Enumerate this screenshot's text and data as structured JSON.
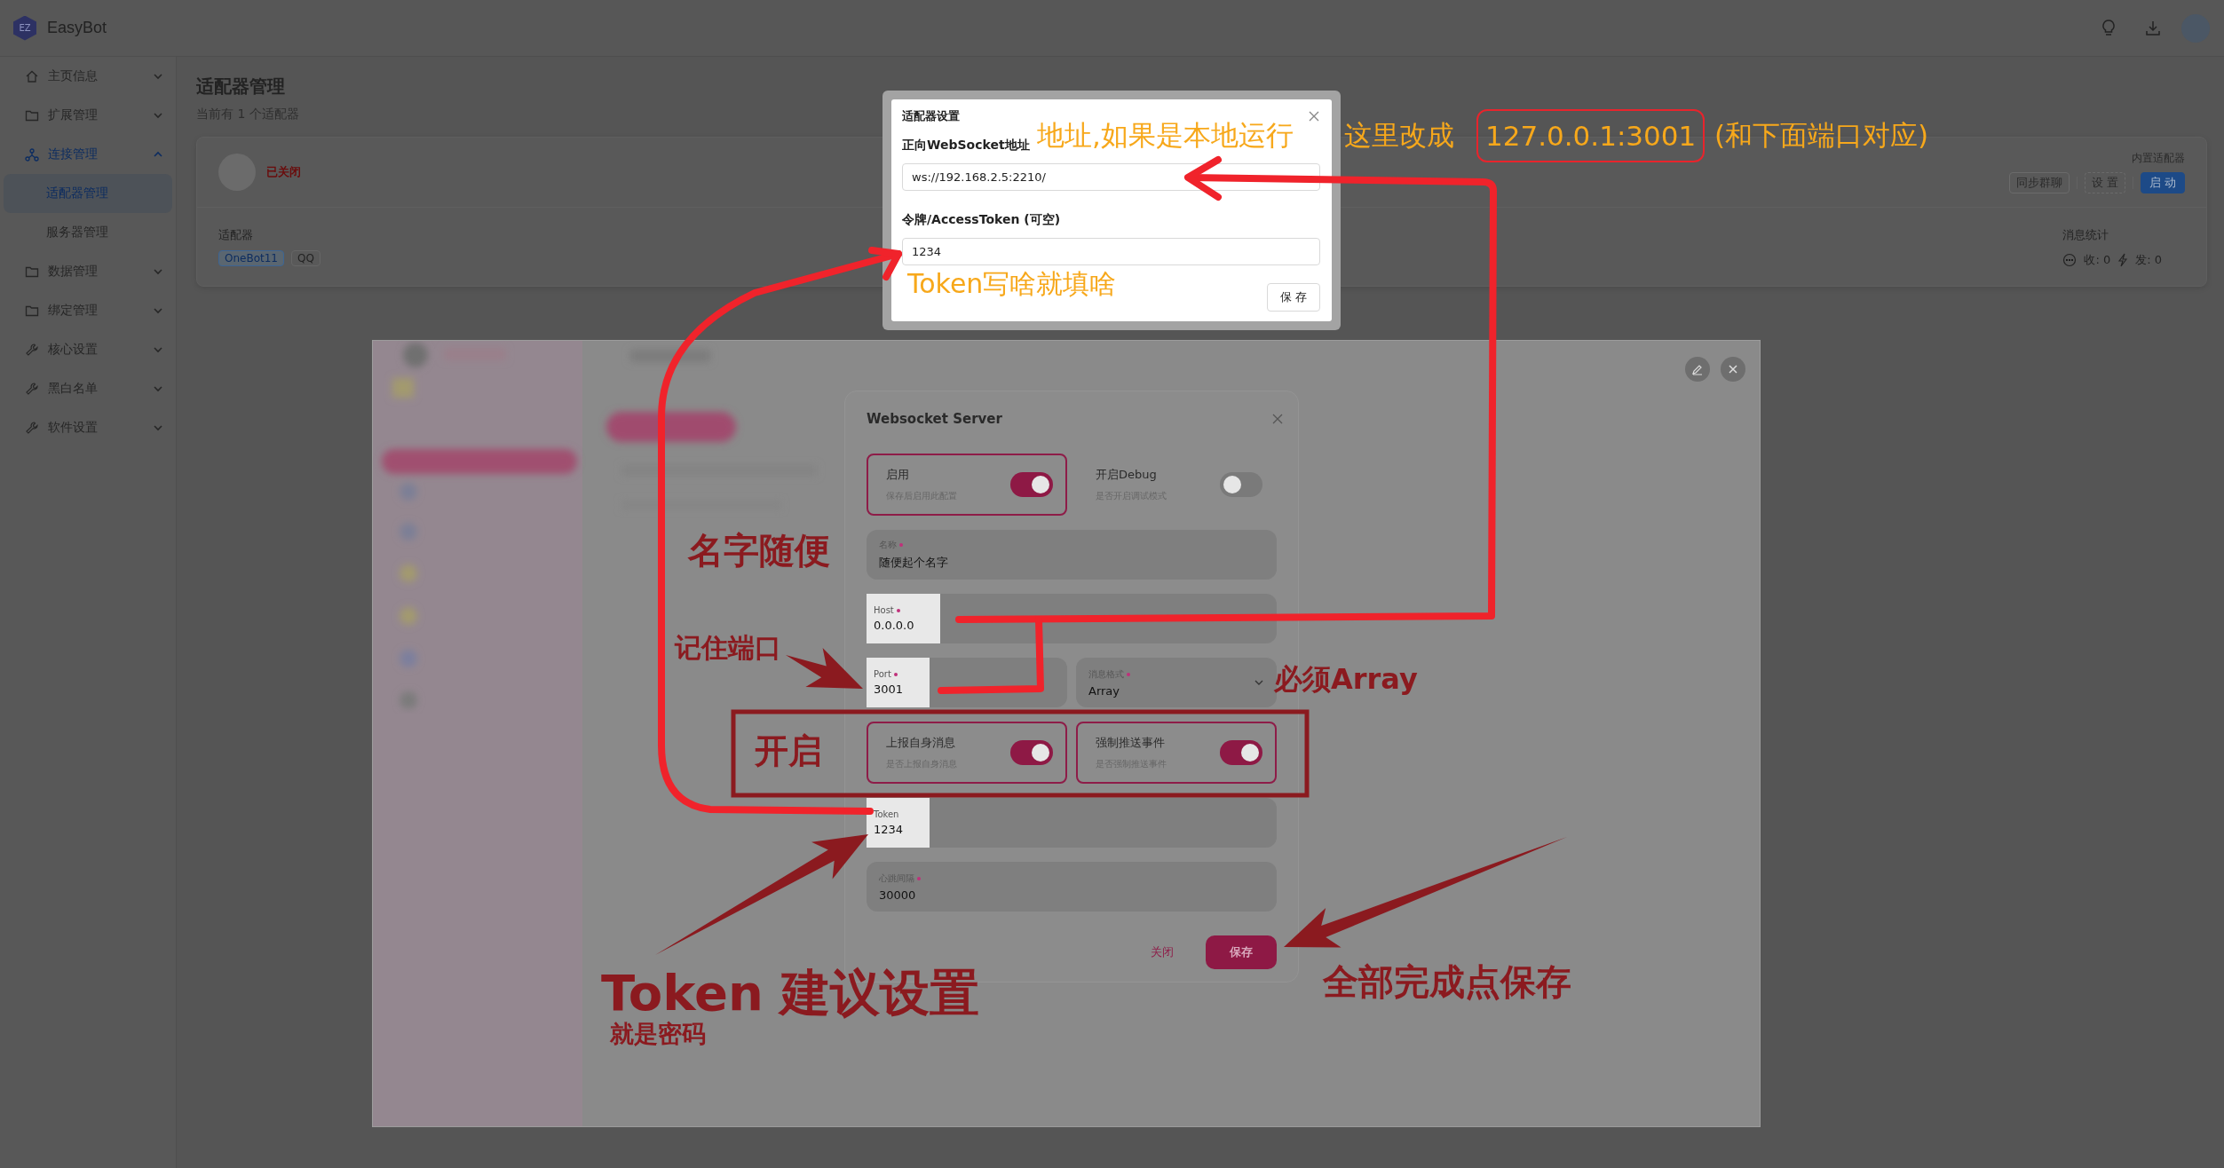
{
  "app": {
    "name": "EasyBot",
    "logo_text": "EZ"
  },
  "sidebar": {
    "items": [
      {
        "label": "主页信息",
        "kind": "home",
        "expanded": false,
        "selected": false
      },
      {
        "label": "扩展管理",
        "kind": "folder",
        "expanded": false,
        "selected": false
      },
      {
        "label": "连接管理",
        "kind": "nodes",
        "expanded": true,
        "selected": true,
        "children": [
          {
            "label": "适配器管理",
            "selected": true
          },
          {
            "label": "服务器管理",
            "selected": false
          }
        ]
      },
      {
        "label": "数据管理",
        "kind": "folder",
        "expanded": false,
        "selected": false
      },
      {
        "label": "绑定管理",
        "kind": "folder",
        "expanded": false,
        "selected": false
      },
      {
        "label": "核心设置",
        "kind": "wrench",
        "expanded": false,
        "selected": false
      },
      {
        "label": "黑白名单",
        "kind": "wrench",
        "expanded": false,
        "selected": false
      },
      {
        "label": "软件设置",
        "kind": "wrench",
        "expanded": false,
        "selected": false
      }
    ]
  },
  "page": {
    "title": "适配器管理",
    "subtitle": "当前有 1 个适配器"
  },
  "adapter_card": {
    "status": "已关闭",
    "type_label": "内置适配器",
    "actions": [
      {
        "label": "同步群聊",
        "kind": "default"
      },
      {
        "label": "设 置",
        "kind": "dashed"
      },
      {
        "label": "启 动",
        "kind": "primary"
      }
    ],
    "section_label": "适配器",
    "tags": [
      {
        "label": "OneBot11",
        "selected": true
      },
      {
        "label": "QQ",
        "selected": false
      }
    ],
    "stats_label": "消息统计",
    "received": "收: 0",
    "sent": "发: 0"
  },
  "settings_dialog": {
    "title": "适配器设置",
    "fields": [
      {
        "label": "正向WebSocket地址",
        "value": "ws://192.168.2.5:2210/"
      },
      {
        "label": "令牌/AccessToken (可空)",
        "value": "1234"
      }
    ],
    "save": "保 存"
  },
  "embedded_screenshot": {
    "dialog": {
      "title": "Websocket Server",
      "rows": [
        {
          "kind": "toggles",
          "items": [
            {
              "label": "启用",
              "hint": "保存后启用此配置",
              "on": true
            },
            {
              "label": "开启Debug",
              "hint": "是否开启调试模式",
              "on": false
            }
          ]
        },
        {
          "kind": "field",
          "label": "名称",
          "required": true,
          "value": "随便起个名字",
          "highlighted": false
        },
        {
          "kind": "field",
          "label": "Host",
          "required": true,
          "value": "0.0.0.0",
          "highlighted": true
        },
        {
          "kind": "pair",
          "items": [
            {
              "kind": "field",
              "label": "Port",
              "required": true,
              "value": "3001",
              "highlighted": true
            },
            {
              "kind": "select",
              "label": "消息格式",
              "required": true,
              "value": "Array",
              "highlighted": false
            }
          ]
        },
        {
          "kind": "toggles",
          "items": [
            {
              "label": "上报自身消息",
              "hint": "是否上报自身消息",
              "on": true
            },
            {
              "label": "强制推送事件",
              "hint": "是否强制推送事件",
              "on": true
            }
          ]
        },
        {
          "kind": "field",
          "label": "Token",
          "required": false,
          "value": "1234",
          "highlighted": true
        },
        {
          "kind": "field",
          "label": "心跳间隔",
          "required": true,
          "value": "30000",
          "highlighted": false
        }
      ],
      "cancel": "关闭",
      "save": "保存"
    }
  },
  "annotations": [
    {
      "text": "地址,如果是本地运行",
      "kind": "handwritten",
      "color": "#f7a81b"
    },
    {
      "text": "这里改成",
      "kind": "handwritten",
      "color": "#f7a81b"
    },
    {
      "text": "127.0.0.1:3001",
      "kind": "boxed",
      "color": "#f7a81b"
    },
    {
      "text": "(和下面端口对应)",
      "kind": "handwritten",
      "color": "#f7a81b"
    },
    {
      "text": "Token写啥就填啥",
      "kind": "handwritten",
      "color": "#f7a81b"
    },
    {
      "text": "名字随便",
      "kind": "label",
      "color": "#8b1a1f"
    },
    {
      "text": "记住端口",
      "kind": "label",
      "color": "#8b1a1f"
    },
    {
      "text": "必须Array",
      "kind": "label",
      "color": "#8b1a1f"
    },
    {
      "text": "开启",
      "kind": "label",
      "color": "#8b1a1f"
    },
    {
      "text": "Token 建议设置",
      "kind": "label",
      "color": "#8b1a1f"
    },
    {
      "text": "就是密码",
      "kind": "label",
      "color": "#8b1a1f"
    },
    {
      "text": "全部完成点保存",
      "kind": "label",
      "color": "#8b1a1f"
    }
  ]
}
